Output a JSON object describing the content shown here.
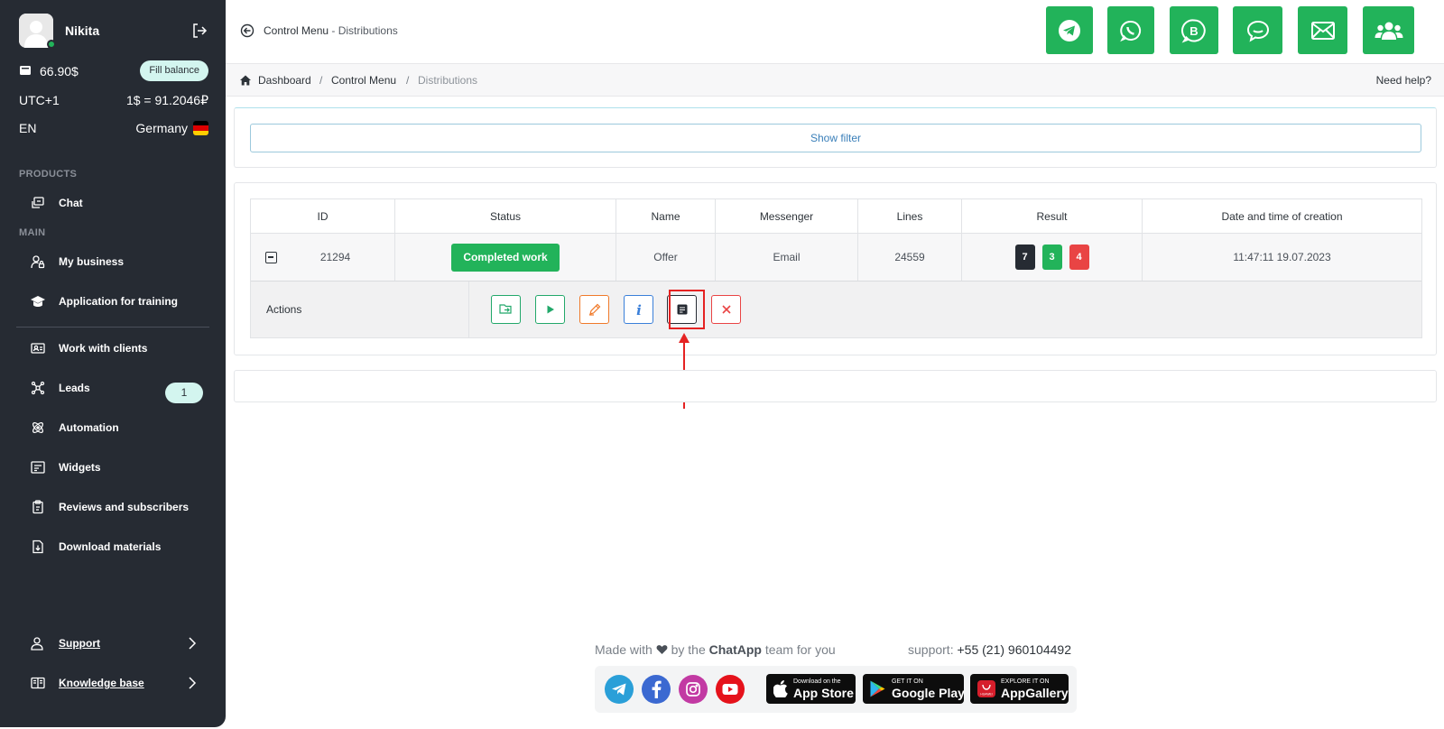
{
  "user": {
    "name": "Nikita",
    "balance": "66.90$",
    "fill_balance_label": "Fill balance"
  },
  "locale": {
    "timezone": "UTC+1",
    "rate": "1$ = 91.2046₽",
    "language": "EN",
    "country": "Germany"
  },
  "sidebar": {
    "sections": {
      "products": "PRODUCTS",
      "main": "MAIN"
    },
    "items": [
      {
        "label": "Chat",
        "icon": "chat-window-icon"
      },
      {
        "label": "My business",
        "icon": "user-lock-icon"
      },
      {
        "label": "Application for training",
        "icon": "graduation-cap-icon"
      },
      {
        "label": "Work with clients",
        "icon": "id-card-icon"
      },
      {
        "label": "Leads",
        "icon": "network-icon",
        "badge": "1"
      },
      {
        "label": "Automation",
        "icon": "atom-icon"
      },
      {
        "label": "Widgets",
        "icon": "widget-window-icon"
      },
      {
        "label": "Reviews and subscribers",
        "icon": "clipboard-icon"
      },
      {
        "label": "Download materials",
        "icon": "file-download-icon"
      }
    ],
    "bottom": [
      {
        "label": "Support",
        "icon": "support-user-icon"
      },
      {
        "label": "Knowledge base",
        "icon": "book-icon"
      }
    ]
  },
  "header": {
    "title": "Control Menu",
    "title_separator": " - ",
    "title_sub": "Distributions",
    "messenger_buttons": [
      "telegram-icon",
      "whatsapp-icon",
      "whatsapp-business-icon",
      "chat-bubble-icon",
      "email-icon",
      "users-icon"
    ]
  },
  "breadcrumb": {
    "items": [
      "Dashboard",
      "Control Menu",
      "Distributions"
    ],
    "separator": "/",
    "need_help": "Need help?"
  },
  "filter": {
    "show_filter_label": "Show filter"
  },
  "table": {
    "columns": [
      "ID",
      "Status",
      "Name",
      "Messenger",
      "Lines",
      "Result",
      "Date and time of creation"
    ],
    "rows": [
      {
        "id": "21294",
        "status": "Completed work",
        "name": "Offer",
        "messenger": "Email",
        "lines": "24559",
        "result": {
          "total": "7",
          "success": "3",
          "failed": "4"
        },
        "created": "11:47:11 19.07.2023"
      }
    ],
    "actions_label": "Actions",
    "action_buttons": [
      "copy-folder-icon",
      "play-icon",
      "edit-pen-icon",
      "info-icon",
      "report-icon",
      "close-icon"
    ]
  },
  "footer": {
    "made_with_prefix": "Made with",
    "made_with_by": "by the",
    "brand": "ChatApp",
    "made_with_suffix": "team for you",
    "support_label": "support:",
    "support_phone": "+55 (21) 960104492",
    "social": [
      "telegram-icon",
      "facebook-icon",
      "instagram-icon",
      "youtube-icon"
    ],
    "stores": [
      {
        "small": "Download on the",
        "big": "App Store"
      },
      {
        "small": "GET IT ON",
        "big": "Google Play"
      },
      {
        "small": "EXPLORE IT ON",
        "big": "AppGallery"
      }
    ]
  },
  "colors": {
    "sidebar_bg": "#262b33",
    "accent_green": "#22b35a",
    "badge_bg": "#d3f5ef",
    "danger": "#e94444",
    "dark": "#262b33",
    "info_blue": "#3a7fd9",
    "orange": "#f07a2a"
  }
}
